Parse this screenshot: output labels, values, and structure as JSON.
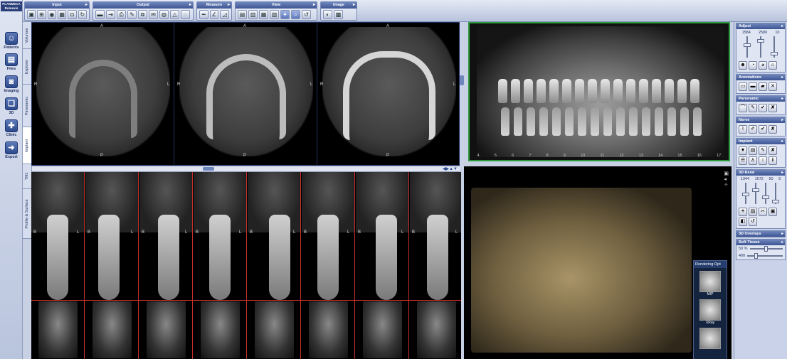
{
  "app": {
    "logo_line1": "PLANMECA",
    "logo_line2": "Romexis"
  },
  "nav": [
    {
      "label": "Patients",
      "icon": "user-icon"
    },
    {
      "label": "Files",
      "icon": "files-icon"
    },
    {
      "label": "Imaging",
      "icon": "imaging-icon"
    },
    {
      "label": "3D",
      "icon": "3d-icon"
    },
    {
      "label": "Clinic",
      "icon": "clinic-icon"
    },
    {
      "label": "Export",
      "icon": "export-icon"
    }
  ],
  "vtabs": [
    "Volumes",
    "Explorer",
    "Panoramic",
    "Implant",
    "TMJ",
    "Profile & Surface"
  ],
  "toolbar": {
    "groups": [
      {
        "title": "Input"
      },
      {
        "title": "Output"
      },
      {
        "title": "Measure"
      },
      {
        "title": "View"
      },
      {
        "title": "Image"
      }
    ]
  },
  "axial": {
    "top": "A",
    "bottom": "P",
    "left": "R",
    "right": "L"
  },
  "sagittal": {
    "left": "B",
    "right": "L"
  },
  "rendering": {
    "title": "Rendering Opt",
    "thumbs": [
      "MIP",
      "XRay",
      ""
    ]
  },
  "right_panel": {
    "adjust": {
      "title": "Adjust",
      "values": [
        "1584",
        "2580",
        "10"
      ]
    },
    "annotations": {
      "title": "Annotations"
    },
    "panoramic": {
      "title": "Panoramic"
    },
    "nerve": {
      "title": "Nerve"
    },
    "implant": {
      "title": "Implant"
    },
    "rend3d": {
      "title": "3D Rend",
      "values": [
        "1344",
        "1672",
        "50",
        "9"
      ]
    },
    "overlays": {
      "title": "3D Overlays"
    },
    "soft": {
      "title": "Soft Tissue",
      "v1": "50 %",
      "v2": "400"
    }
  },
  "pano_ticks": [
    "4",
    "5",
    "6",
    "7",
    "8",
    "9",
    "10",
    "11",
    "12",
    "13",
    "14",
    "15",
    "16",
    "17"
  ]
}
